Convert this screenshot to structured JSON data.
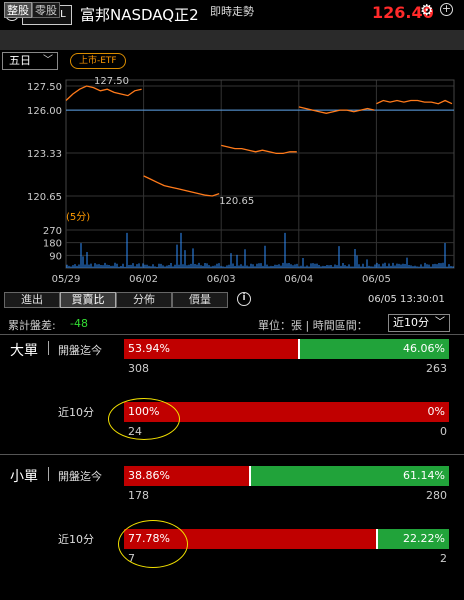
{
  "header": {
    "code": "00670L",
    "name": "富邦NASDAQ正2",
    "price": "126.40"
  },
  "subbar": {
    "tab_whole": "整股",
    "tab_odd": "零股",
    "title": "即時走勢"
  },
  "period": {
    "selected": "五日"
  },
  "etf_badge": "上市-ETF",
  "chart": {
    "y_ticks": [
      "127.50",
      "126.00",
      "123.33",
      "120.65"
    ],
    "high_label": "127.50",
    "low_label": "120.65",
    "interval_label": "(5分)",
    "vol_ticks": [
      "270",
      "180",
      "90"
    ],
    "x_labels": [
      "05/29",
      "06/02",
      "06/03",
      "06/04",
      "06/05"
    ]
  },
  "chart_data": {
    "type": "line",
    "ylim": [
      120.65,
      127.5
    ],
    "reference": 126.0,
    "days": [
      "05/29",
      "06/02",
      "06/03",
      "06/04",
      "06/05"
    ],
    "series": [
      {
        "values": [
          126.6,
          127.0,
          127.3,
          127.5,
          127.4,
          127.2,
          127.3,
          127.1,
          127.0,
          126.9,
          127.2,
          127.3
        ]
      },
      {
        "values": [
          121.9,
          121.7,
          121.5,
          121.3,
          121.2,
          121.1,
          121.0,
          120.9,
          120.8,
          120.7,
          120.65,
          120.8
        ]
      },
      {
        "values": [
          123.8,
          123.7,
          123.6,
          123.6,
          123.5,
          123.4,
          123.5,
          123.4,
          123.3,
          123.3,
          123.4,
          123.4
        ]
      },
      {
        "values": [
          126.2,
          126.1,
          126.0,
          125.9,
          125.8,
          125.9,
          126.0,
          126.0,
          125.9,
          126.0,
          126.1,
          126.0
        ]
      },
      {
        "values": [
          126.4,
          126.6,
          126.5,
          126.6,
          126.5,
          126.6,
          126.6,
          126.5,
          126.5,
          126.4,
          126.6,
          126.4
        ]
      }
    ],
    "volume_ylim": [
      0,
      270
    ]
  },
  "tabs": {
    "t1": "進出",
    "t2": "買賣比",
    "t3": "分佈",
    "t4": "價量"
  },
  "datetime": "06/05 13:30:01",
  "cumulative": {
    "label": "累計盤差:",
    "value": "-48"
  },
  "unit_text": "單位：張 | 時間區間：",
  "interval": "近10分",
  "big": {
    "title": "大單",
    "open_label": "開盤迄今",
    "open_buy_pct": "53.94%",
    "open_sell_pct": "46.06%",
    "open_buy_frac": 0.5394,
    "open_buy_cnt": "308",
    "open_sell_cnt": "263",
    "recent_label": "近10分",
    "recent_buy_pct": "100%",
    "recent_sell_pct": "0%",
    "recent_buy_frac": 1.0,
    "recent_buy_cnt": "24",
    "recent_sell_cnt": "0"
  },
  "small": {
    "title": "小單",
    "open_label": "開盤迄今",
    "open_buy_pct": "38.86%",
    "open_sell_pct": "61.14%",
    "open_buy_frac": 0.3886,
    "open_buy_cnt": "178",
    "open_sell_cnt": "280",
    "recent_label": "近10分",
    "recent_buy_pct": "77.78%",
    "recent_sell_pct": "22.22%",
    "recent_buy_frac": 0.7778,
    "recent_buy_cnt": "7",
    "recent_sell_cnt": "2"
  },
  "colors": {
    "buy": "#c00000",
    "sell": "#21a33a",
    "up": "#ff2a2a",
    "down": "#33dd33",
    "price_line": "#ff7a1a",
    "reference_line": "#5aa0e6",
    "volume": "#2f8fff",
    "highlight": "#f2e000"
  }
}
